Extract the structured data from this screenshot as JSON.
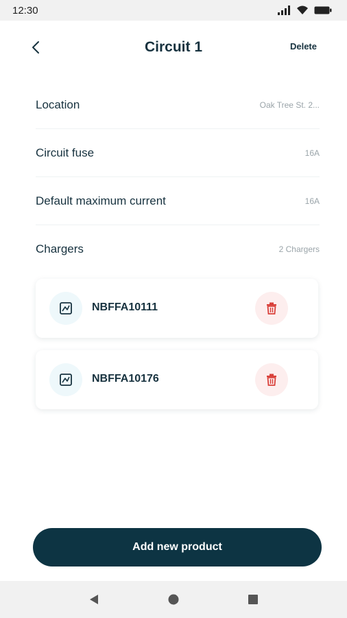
{
  "status_bar": {
    "time": "12:30"
  },
  "header": {
    "title": "Circuit 1",
    "delete_label": "Delete"
  },
  "rows": [
    {
      "label": "Location",
      "value": "Oak Tree St. 2..."
    },
    {
      "label": "Circuit fuse",
      "value": "16A"
    },
    {
      "label": "Default maximum current",
      "value": "16A"
    },
    {
      "label": "Chargers",
      "value": "2 Chargers"
    }
  ],
  "chargers": [
    {
      "id": "NBFFA10111",
      "icon": "charger-icon",
      "action_icon": "trash-icon"
    },
    {
      "id": "NBFFA10176",
      "icon": "charger-icon",
      "action_icon": "trash-icon"
    }
  ],
  "footer": {
    "add_label": "Add new product"
  },
  "colors": {
    "primary": "#0d3443",
    "text": "#17323f",
    "muted": "#9aa4a9",
    "danger": "#d9403a",
    "danger_bg": "#fdeeee",
    "icon_bg": "#eef8fb"
  },
  "nav": {
    "icons": [
      "back-triangle-icon",
      "home-circle-icon",
      "recents-square-icon"
    ]
  }
}
